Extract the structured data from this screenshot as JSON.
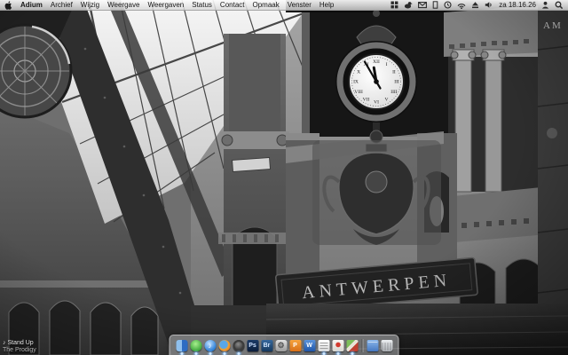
{
  "menu_bar": {
    "app_menu_items": [
      "Adium",
      "Archief",
      "Wijzig",
      "Weergave",
      "Weergaven",
      "Status",
      "Contact",
      "Opmaak",
      "Venster",
      "Help"
    ],
    "clock_text": "za 18.16.26",
    "status_icon_names": [
      "spaces-grid",
      "adium-status-duck",
      "mail-envelope",
      "script-doc",
      "time-machine-clock",
      "airport-wifi",
      "eject",
      "volume-speaker",
      "fast-user-switch",
      "spotlight-search"
    ]
  },
  "wallpaper": {
    "description": "Black-and-white photograph of the Antwerpen-Centraal railway station interior: iron-and-glass roof at top left, ornate stone facade with large clock and carved coat of arms",
    "station_sign_text": "ANTWERPEN",
    "stone_inscription": "AM"
  },
  "now_playing": {
    "note_glyph": "♪",
    "track": "Stand Up",
    "artist": "The Prodigy"
  },
  "dock": {
    "items": [
      {
        "icon": "finder",
        "running": true
      },
      {
        "icon": "adium-duck",
        "running": true
      },
      {
        "icon": "itunes",
        "running": true
      },
      {
        "icon": "firefox",
        "running": true
      },
      {
        "icon": "dark-dial-app",
        "running": true
      },
      {
        "icon": "photoshop",
        "glyph": "Ps",
        "running": false
      },
      {
        "icon": "adobe-bridge",
        "glyph": "Br",
        "running": false
      },
      {
        "icon": "system-preferences",
        "glyph": "⚙",
        "running": false
      },
      {
        "icon": "powerpoint",
        "glyph": "P",
        "running": false
      },
      {
        "icon": "word",
        "glyph": "W",
        "running": false
      },
      {
        "icon": "textedit",
        "running": true
      },
      {
        "icon": "white-red-app",
        "running": true
      },
      {
        "icon": "multicolor-app",
        "running": true
      },
      {
        "icon": "documents-folder",
        "running": false
      },
      {
        "icon": "trash",
        "running": false
      }
    ]
  }
}
